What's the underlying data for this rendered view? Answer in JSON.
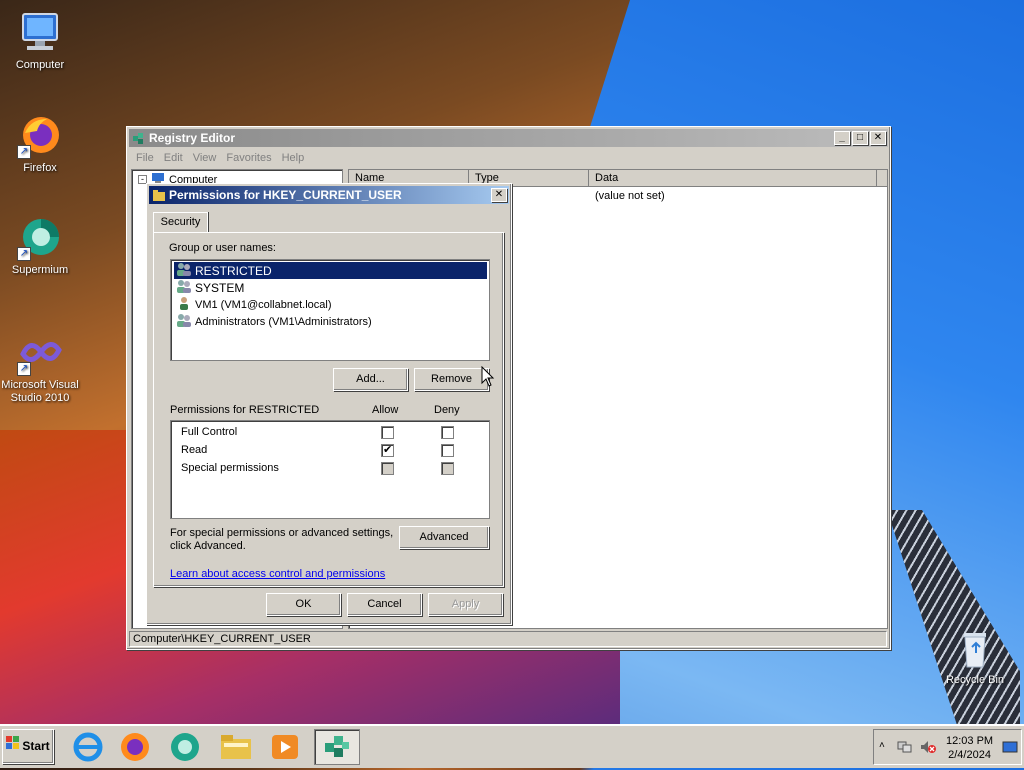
{
  "desktop": {
    "icons": [
      {
        "label": "Computer"
      },
      {
        "label": "Firefox"
      },
      {
        "label": "Supermium"
      },
      {
        "label": "Microsoft Visual Studio 2010"
      },
      {
        "label": "Recycle Bin"
      }
    ]
  },
  "regedit": {
    "title": "Registry Editor",
    "menu": [
      "File",
      "Edit",
      "View",
      "Favorites",
      "Help"
    ],
    "tree_root": "Computer",
    "columns": [
      "Name",
      "Type",
      "Data"
    ],
    "row_data": "(value not set)",
    "status": "Computer\\HKEY_CURRENT_USER"
  },
  "perm": {
    "title": "Permissions for HKEY_CURRENT_USER",
    "tab": "Security",
    "group_label": "Group or user names:",
    "users": [
      {
        "name": "RESTRICTED"
      },
      {
        "name": "SYSTEM"
      },
      {
        "name": "VM1 (VM1@collabnet.local)"
      },
      {
        "name": "Administrators (VM1\\Administrators)"
      }
    ],
    "add_label": "Add...",
    "remove_label": "Remove",
    "perm_for": "Permissions for RESTRICTED",
    "allow_label": "Allow",
    "deny_label": "Deny",
    "perms": [
      {
        "name": "Full Control",
        "allow": false,
        "deny": false
      },
      {
        "name": "Read",
        "allow": true,
        "deny": false
      },
      {
        "name": "Special permissions",
        "allow": false,
        "deny": false
      }
    ],
    "special_text_1": "For special permissions or advanced settings,",
    "special_text_2": "click Advanced.",
    "advanced_label": "Advanced",
    "learn_link": "Learn about access control and permissions",
    "ok_label": "OK",
    "cancel_label": "Cancel",
    "apply_label": "Apply"
  },
  "taskbar": {
    "start_label": "Start",
    "time": "12:03 PM",
    "date": "2/4/2024"
  }
}
